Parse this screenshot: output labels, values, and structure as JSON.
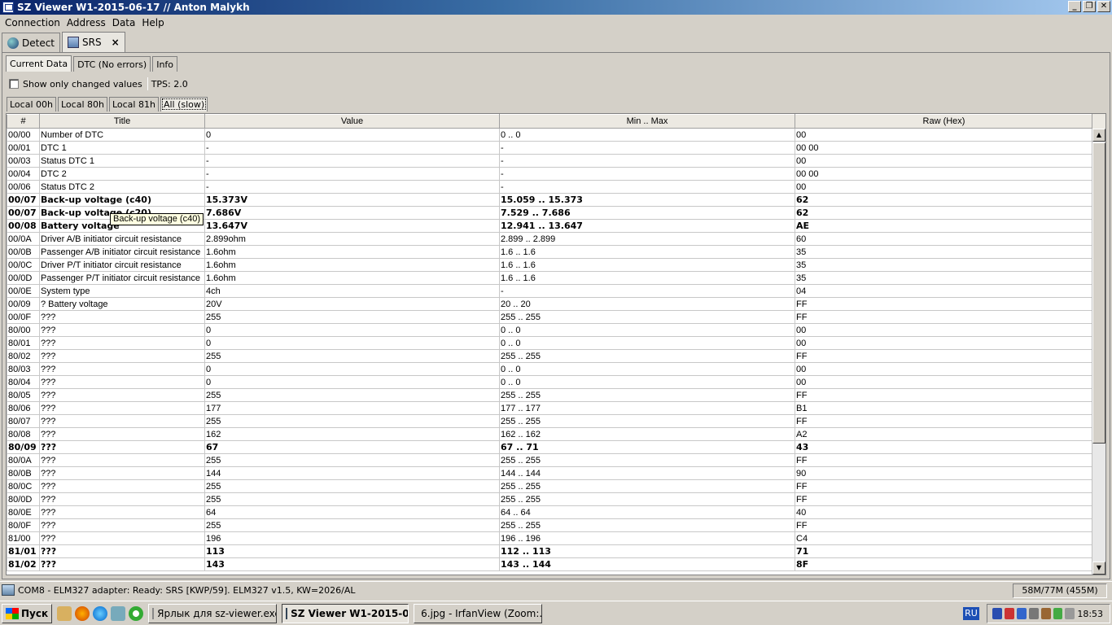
{
  "window": {
    "title": "SZ Viewer W1-2015-06-17 // Anton Malykh",
    "btn_min": "_",
    "btn_max": "❐",
    "btn_close": "✕"
  },
  "menu": [
    "Connection",
    "Address",
    "Data",
    "Help"
  ],
  "top_tabs": {
    "detect": "Detect",
    "srs": "SRS",
    "close": "×"
  },
  "sub_tabs": [
    "Current Data",
    "DTC (No errors)",
    "Info"
  ],
  "options": {
    "show_changed": "Show only changed values",
    "tps": "TPS: 2.0"
  },
  "local_tabs": [
    "Local 00h",
    "Local 80h",
    "Local 81h",
    "All (slow)"
  ],
  "table": {
    "columns": [
      "#",
      "Title",
      "Value",
      "Min .. Max",
      "Raw (Hex)"
    ],
    "rows": [
      {
        "id": "00/00",
        "title": "Number of DTC",
        "value": "0",
        "minmax": "0 .. 0",
        "raw": "00",
        "bold": false
      },
      {
        "id": "00/01",
        "title": "DTC 1",
        "value": "-",
        "minmax": "-",
        "raw": "00 00",
        "bold": false
      },
      {
        "id": "00/03",
        "title": "Status DTC 1",
        "value": "-",
        "minmax": "-",
        "raw": "00",
        "bold": false
      },
      {
        "id": "00/04",
        "title": "DTC 2",
        "value": "-",
        "minmax": "-",
        "raw": "00 00",
        "bold": false
      },
      {
        "id": "00/06",
        "title": "Status DTC 2",
        "value": "-",
        "minmax": "-",
        "raw": "00",
        "bold": false
      },
      {
        "id": "00/07",
        "title": "Back-up voltage (c40)",
        "value": "15.373V",
        "minmax": "15.059 .. 15.373",
        "raw": "62",
        "bold": true
      },
      {
        "id": "00/07",
        "title": "Back-up voltage (c20)",
        "value": "7.686V",
        "minmax": "7.529 .. 7.686",
        "raw": "62",
        "bold": true
      },
      {
        "id": "00/08",
        "title": "Battery voltage",
        "value": "13.647V",
        "minmax": "12.941 .. 13.647",
        "raw": "AE",
        "bold": true
      },
      {
        "id": "00/0A",
        "title": "Driver A/B initiator circuit resistance",
        "value": "2.899ohm",
        "minmax": "2.899 .. 2.899",
        "raw": "60",
        "bold": false
      },
      {
        "id": "00/0B",
        "title": "Passenger A/B initiator circuit resistance",
        "value": "1.6ohm",
        "minmax": "1.6 .. 1.6",
        "raw": "35",
        "bold": false
      },
      {
        "id": "00/0C",
        "title": "Driver P/T initiator circuit resistance",
        "value": "1.6ohm",
        "minmax": "1.6 .. 1.6",
        "raw": "35",
        "bold": false
      },
      {
        "id": "00/0D",
        "title": "Passenger P/T initiator circuit resistance",
        "value": "1.6ohm",
        "minmax": "1.6 .. 1.6",
        "raw": "35",
        "bold": false
      },
      {
        "id": "00/0E",
        "title": "System type",
        "value": "4ch",
        "minmax": "-",
        "raw": "04",
        "bold": false
      },
      {
        "id": "00/09",
        "title": "? Battery voltage",
        "value": "20V",
        "minmax": "20 .. 20",
        "raw": "FF",
        "bold": false
      },
      {
        "id": "00/0F",
        "title": "???",
        "value": "255",
        "minmax": "255 .. 255",
        "raw": "FF",
        "bold": false
      },
      {
        "id": "80/00",
        "title": "???",
        "value": "0",
        "minmax": "0 .. 0",
        "raw": "00",
        "bold": false
      },
      {
        "id": "80/01",
        "title": "???",
        "value": "0",
        "minmax": "0 .. 0",
        "raw": "00",
        "bold": false
      },
      {
        "id": "80/02",
        "title": "???",
        "value": "255",
        "minmax": "255 .. 255",
        "raw": "FF",
        "bold": false
      },
      {
        "id": "80/03",
        "title": "???",
        "value": "0",
        "minmax": "0 .. 0",
        "raw": "00",
        "bold": false
      },
      {
        "id": "80/04",
        "title": "???",
        "value": "0",
        "minmax": "0 .. 0",
        "raw": "00",
        "bold": false
      },
      {
        "id": "80/05",
        "title": "???",
        "value": "255",
        "minmax": "255 .. 255",
        "raw": "FF",
        "bold": false
      },
      {
        "id": "80/06",
        "title": "???",
        "value": "177",
        "minmax": "177 .. 177",
        "raw": "B1",
        "bold": false
      },
      {
        "id": "80/07",
        "title": "???",
        "value": "255",
        "minmax": "255 .. 255",
        "raw": "FF",
        "bold": false
      },
      {
        "id": "80/08",
        "title": "???",
        "value": "162",
        "minmax": "162 .. 162",
        "raw": "A2",
        "bold": false
      },
      {
        "id": "80/09",
        "title": "???",
        "value": "67",
        "minmax": "67 .. 71",
        "raw": "43",
        "bold": true
      },
      {
        "id": "80/0A",
        "title": "???",
        "value": "255",
        "minmax": "255 .. 255",
        "raw": "FF",
        "bold": false
      },
      {
        "id": "80/0B",
        "title": "???",
        "value": "144",
        "minmax": "144 .. 144",
        "raw": "90",
        "bold": false
      },
      {
        "id": "80/0C",
        "title": "???",
        "value": "255",
        "minmax": "255 .. 255",
        "raw": "FF",
        "bold": false
      },
      {
        "id": "80/0D",
        "title": "???",
        "value": "255",
        "minmax": "255 .. 255",
        "raw": "FF",
        "bold": false
      },
      {
        "id": "80/0E",
        "title": "???",
        "value": "64",
        "minmax": "64 .. 64",
        "raw": "40",
        "bold": false
      },
      {
        "id": "80/0F",
        "title": "???",
        "value": "255",
        "minmax": "255 .. 255",
        "raw": "FF",
        "bold": false
      },
      {
        "id": "81/00",
        "title": "???",
        "value": "196",
        "minmax": "196 .. 196",
        "raw": "C4",
        "bold": false
      },
      {
        "id": "81/01",
        "title": "???",
        "value": "113",
        "minmax": "112 .. 113",
        "raw": "71",
        "bold": true
      },
      {
        "id": "81/02",
        "title": "???",
        "value": "143",
        "minmax": "143 .. 144",
        "raw": "8F",
        "bold": true
      }
    ]
  },
  "tooltip": "Back-up voltage (c40)",
  "scroll": {
    "up": "▲",
    "down": "▼"
  },
  "status": {
    "left": "COM8 - ELM327 adapter: Ready: SRS [KWP/59]. ELM327 v1.5, KW=2026/AL",
    "right": "58M/77M (455M)"
  },
  "taskbar": {
    "start": "Пуск",
    "tasks": [
      {
        "label": "Ярлык для sz-viewer.exe",
        "active": false
      },
      {
        "label": "SZ Viewer W1-2015-0...",
        "active": true
      },
      {
        "label": "6.jpg - IrfanView (Zoom:...",
        "active": false
      }
    ],
    "lang": "RU",
    "clock": "18:53"
  },
  "colors": {
    "title_start": "#0a246a",
    "title_end": "#a6caf0",
    "face": "#d4d0c8"
  }
}
